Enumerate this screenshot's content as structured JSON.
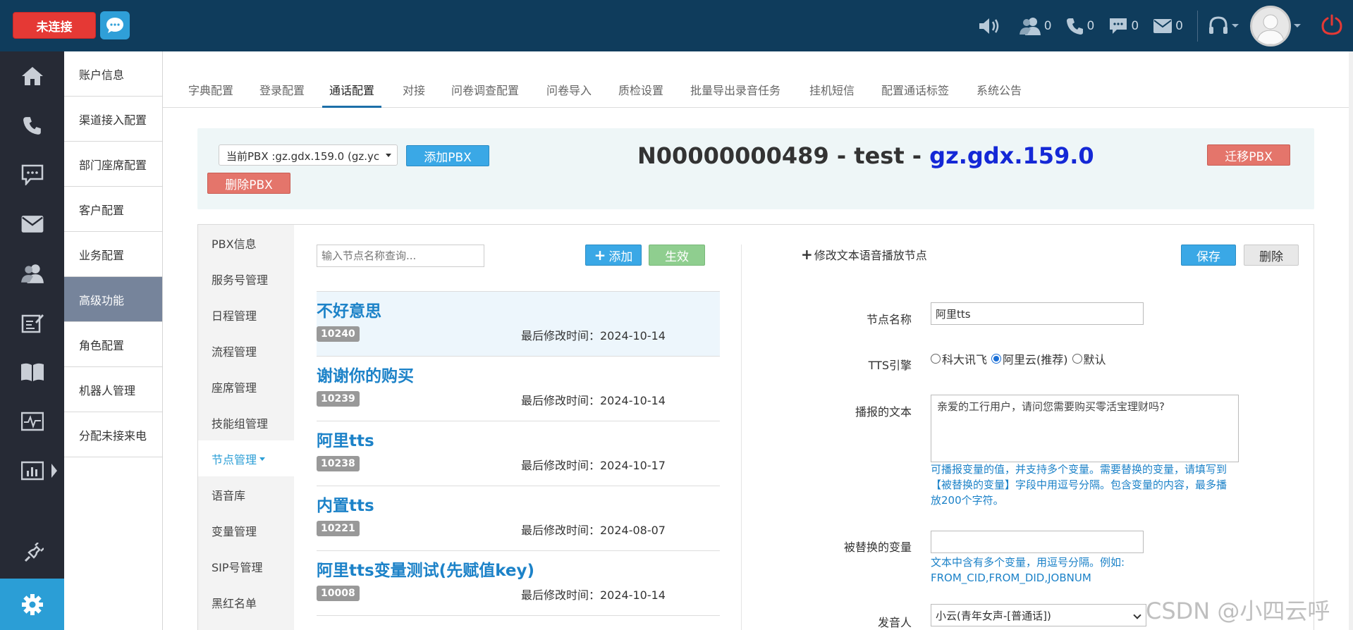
{
  "topbar": {
    "status_label": "未连接",
    "counters": {
      "users": "0",
      "calls": "0",
      "messages": "0",
      "mails": "0"
    }
  },
  "menu": [
    "账户信息",
    "渠道接入配置",
    "部门座席配置",
    "客户配置",
    "业务配置",
    "高级功能",
    "角色配置",
    "机器人管理",
    "分配未接来电"
  ],
  "menu_active": "高级功能",
  "tabs": [
    "字典配置",
    "登录配置",
    "通话配置",
    "对接",
    "问卷调查配置",
    "问卷导入",
    "质检设置",
    "批量导出录音任务",
    "挂机短信",
    "配置通话标签",
    "系统公告"
  ],
  "tab_active": "通话配置",
  "pbx": {
    "select_value": "当前PBX :gz.gdx.159.0 (gz.yc",
    "add_label": "添加PBX",
    "delete_label": "删除PBX",
    "migrate_label": "迁移PBX",
    "title_prefix": "N00000000489 - test - ",
    "title_host": "gz.gdx.159.0"
  },
  "subnav": [
    "PBX信息",
    "服务号管理",
    "日程管理",
    "流程管理",
    "座席管理",
    "技能组管理",
    "节点管理",
    "语音库",
    "变量管理",
    "SIP号管理",
    "黑红名单"
  ],
  "subnav_active": "节点管理",
  "nodes": {
    "search_placeholder": "输入节点名称查询...",
    "add_label": "添加",
    "apply_label": "生效",
    "items": [
      {
        "name": "不好意思",
        "id": "10240",
        "time": "最后修改时间：2024-10-14"
      },
      {
        "name": "谢谢你的购买",
        "id": "10239",
        "time": "最后修改时间：2024-10-14"
      },
      {
        "name": "阿里tts",
        "id": "10238",
        "time": "最后修改时间：2024-10-17"
      },
      {
        "name": "内置tts",
        "id": "10221",
        "time": "最后修改时间：2024-08-07"
      },
      {
        "name": "阿里tts变量测试(先赋值key)",
        "id": "10008",
        "time": "最后修改时间：2024-10-14"
      }
    ]
  },
  "form": {
    "title": "修改文本语音播放节点",
    "save_label": "保存",
    "delete_label": "删除",
    "name_label": "节点名称",
    "name_value": "阿里tts",
    "tts_label": "TTS引擎",
    "tts_options": [
      "科大讯飞",
      "阿里云(推荐)",
      "默认"
    ],
    "tts_selected": "阿里云(推荐)",
    "text_label": "播报的文本",
    "text_value": "亲爱的工行用户，请问您需要购买零活宝理财吗?",
    "text_help": "可播报变量的值，并支持多个变量。需要替换的变量，请填写到【被替换的变量】字段中用逗号分隔。包含变量的内容，最多播放200个字符。",
    "vars_label": "被替换的变量",
    "vars_value": "",
    "vars_help": "文本中含有多个变量，用逗号分隔。例如: FROM_CID,FROM_DID,JOBNUM",
    "speaker_label": "发音人",
    "speaker_value": "小云(青年女声-[普通话])"
  },
  "watermark": "CSDN @小四云呼"
}
